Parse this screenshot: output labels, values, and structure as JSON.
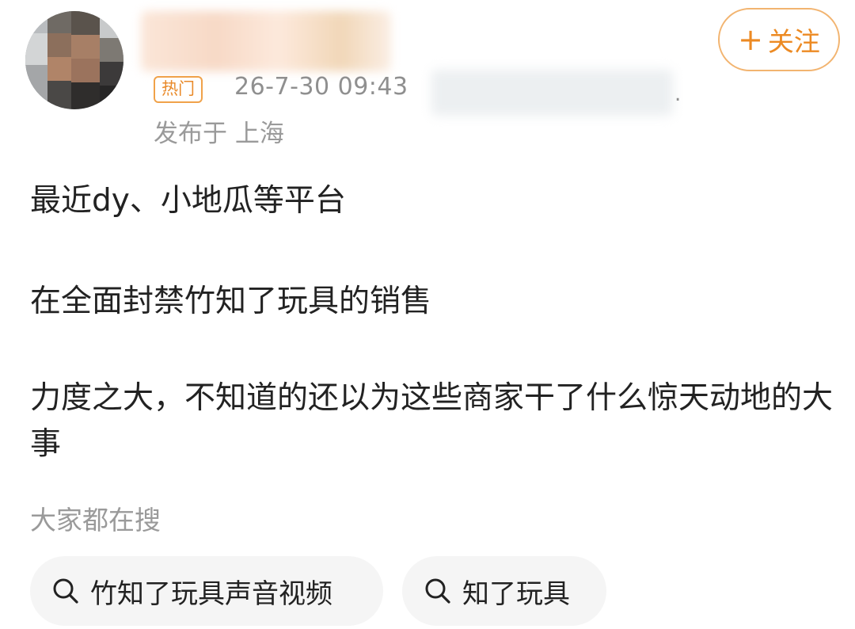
{
  "post": {
    "hot_badge": "热门",
    "time": "26-7-30 09:43",
    "source_trailing": ".",
    "location": "发布于 上海",
    "follow_label": "关注",
    "paragraphs": [
      "最近dy、小地瓜等平台",
      "在全面封禁竹知了玩具的销售",
      "力度之大，不知道的还以为这些商家干了什么惊天动地的大事"
    ]
  },
  "search": {
    "heading": "大家都在搜",
    "chips": [
      {
        "label": "竹知了玩具声音视频",
        "icon": "search-icon"
      },
      {
        "label": "知了玩具",
        "icon": "search-icon"
      }
    ]
  },
  "colors": {
    "accent": "#ec8a23",
    "badge_border": "#f0a24a",
    "meta_text": "#8f8f8f",
    "chip_bg": "#f5f5f5"
  }
}
